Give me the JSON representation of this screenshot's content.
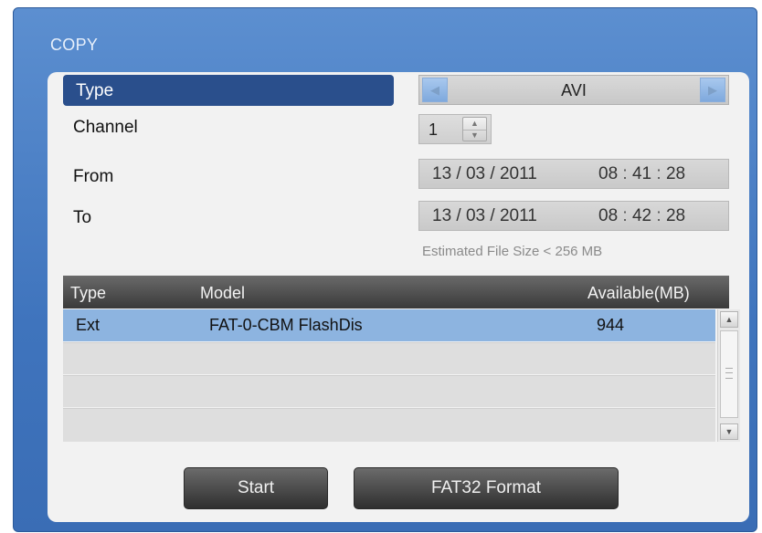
{
  "dialog": {
    "title": "COPY"
  },
  "form": {
    "type_label": "Type",
    "type_value": "AVI",
    "channel_label": "Channel",
    "channel_value": "1",
    "from_label": "From",
    "from_date": "13 / 03 /  2011",
    "from_time": {
      "h": "08",
      "m": "41",
      "s": "28"
    },
    "to_label": "To",
    "to_date": "13 / 03 /  2011",
    "to_time": {
      "h": "08",
      "m": "42",
      "s": "28"
    },
    "time_separator": ":",
    "estimate": "Estimated File Size < 256 MB"
  },
  "devices": {
    "columns": [
      "Type",
      "Model",
      "Available(MB)"
    ],
    "rows": [
      {
        "type": "Ext",
        "model": "FAT-0-CBM FlashDis",
        "available": "944"
      }
    ]
  },
  "buttons": {
    "start": "Start",
    "format": "FAT32 Format"
  },
  "icons": {
    "left": "arrow-left-icon",
    "right": "arrow-right-icon",
    "up": "arrow-up-icon",
    "down": "arrow-down-icon"
  }
}
